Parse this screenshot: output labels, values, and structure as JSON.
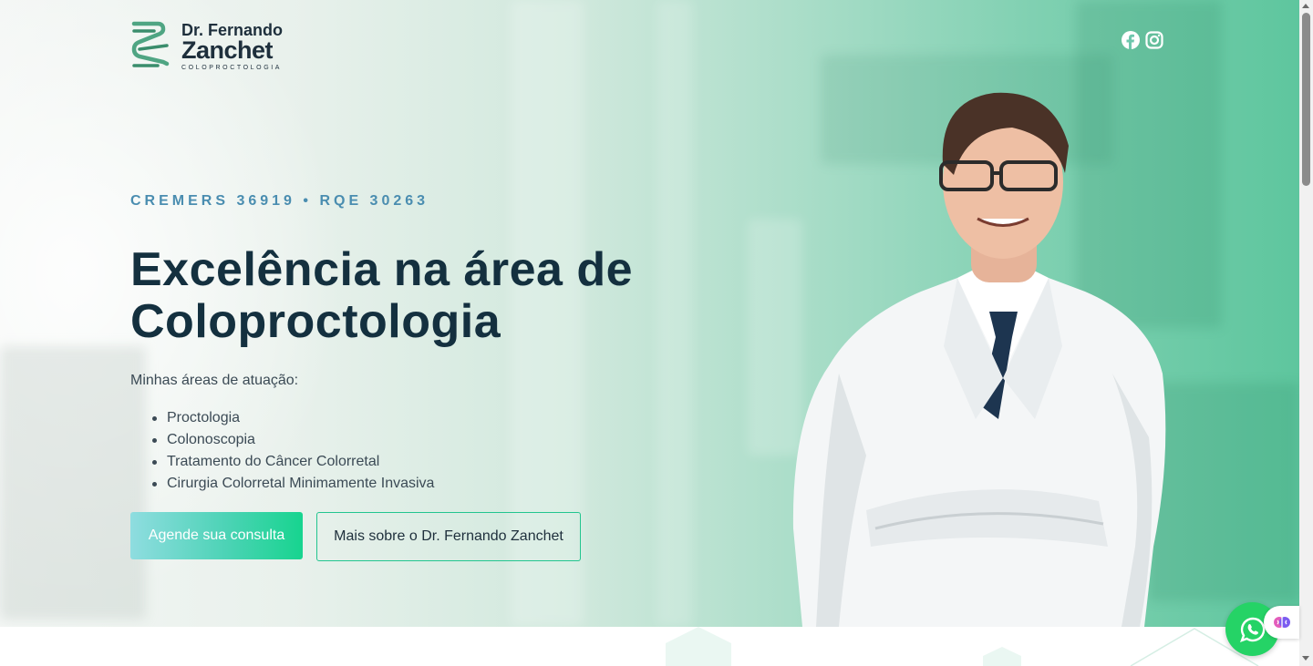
{
  "logo": {
    "line1": "Dr. Fernando",
    "line2": "Zanchet",
    "line3": "COLOPROCTOLOGIA",
    "icon": "intestine-logo-icon"
  },
  "social": {
    "facebook": "facebook-icon",
    "instagram": "instagram-icon"
  },
  "hero": {
    "credential": "CREMERS 36919 • RQE 30263",
    "headline": "Excelência na área de Coloproctologia",
    "areas_title": "Minhas áreas de atuação:",
    "areas": [
      "Proctologia",
      "Colonoscopia",
      "Tratamento do Câncer Colorretal",
      "Cirurgia Colorretal Minimamente Invasiva"
    ],
    "primary_button": "Agende sua consulta",
    "secondary_button": "Mais sobre o Dr. Fernando Zanchet"
  },
  "floating": {
    "whatsapp": "whatsapp-icon",
    "extension": "brain-extension-icon"
  },
  "colors": {
    "accent": "#17d48f",
    "heading": "#14303f",
    "credential": "#4a8db0",
    "whatsapp": "#25d366"
  }
}
